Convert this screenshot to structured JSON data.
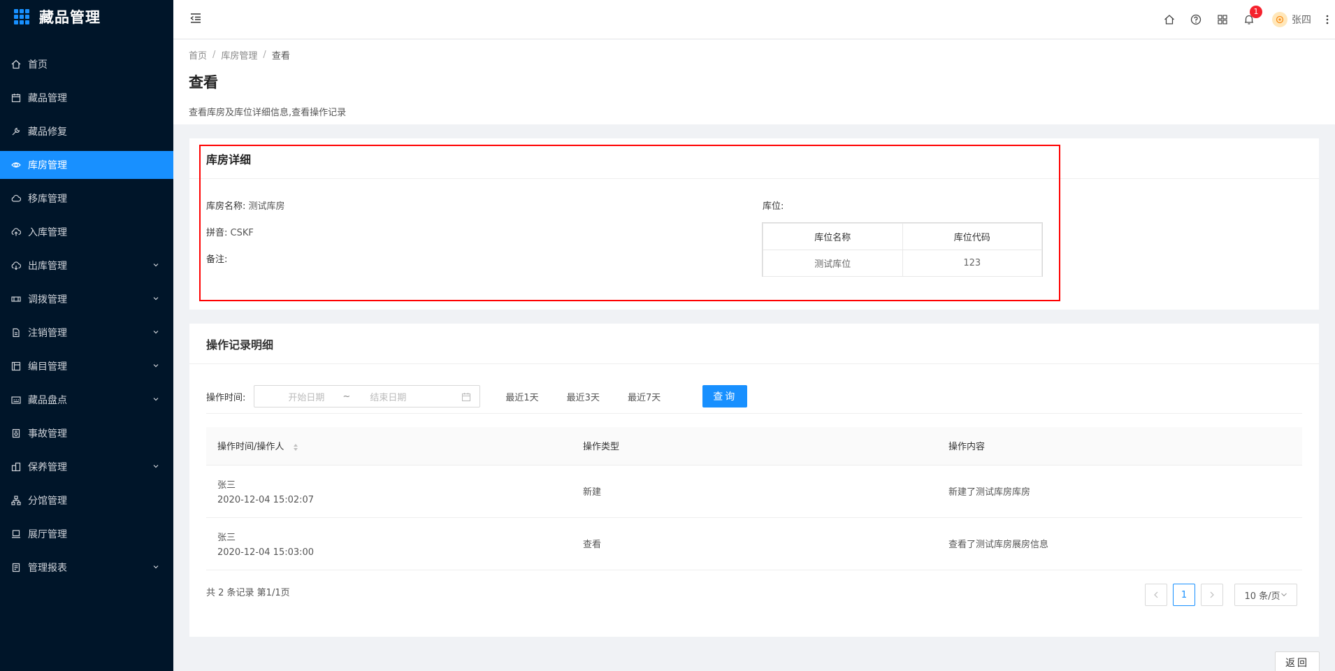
{
  "app": {
    "title": "藏品管理"
  },
  "sidebar": {
    "items": [
      {
        "label": "首页",
        "icon": "home-icon",
        "active": false,
        "has_children": false
      },
      {
        "label": "藏品管理",
        "icon": "calendar-icon",
        "active": false,
        "has_children": false
      },
      {
        "label": "藏品修复",
        "icon": "tool-icon",
        "active": false,
        "has_children": false
      },
      {
        "label": "库房管理",
        "icon": "eye-icon",
        "active": true,
        "has_children": false
      },
      {
        "label": "移库管理",
        "icon": "cloud-icon",
        "active": false,
        "has_children": false
      },
      {
        "label": "入库管理",
        "icon": "cloud-upload-icon",
        "active": false,
        "has_children": false
      },
      {
        "label": "出库管理",
        "icon": "cloud-download-icon",
        "active": false,
        "has_children": true
      },
      {
        "label": "调拨管理",
        "icon": "transfer-icon",
        "active": false,
        "has_children": true
      },
      {
        "label": "注销管理",
        "icon": "file-icon",
        "active": false,
        "has_children": true
      },
      {
        "label": "编目管理",
        "icon": "catalog-icon",
        "active": false,
        "has_children": true
      },
      {
        "label": "藏品盘点",
        "icon": "inventory-icon",
        "active": false,
        "has_children": true
      },
      {
        "label": "事故管理",
        "icon": "report-icon",
        "active": false,
        "has_children": false
      },
      {
        "label": "保养管理",
        "icon": "maintenance-icon",
        "active": false,
        "has_children": true
      },
      {
        "label": "分馆管理",
        "icon": "branch-icon",
        "active": false,
        "has_children": false
      },
      {
        "label": "展厅管理",
        "icon": "laptop-icon",
        "active": false,
        "has_children": false
      },
      {
        "label": "管理报表",
        "icon": "reconciliation-icon",
        "active": false,
        "has_children": true
      }
    ]
  },
  "header": {
    "notification_count": "1",
    "user_name": "张四"
  },
  "breadcrumb": {
    "items": [
      "首页",
      "库房管理",
      "查看"
    ]
  },
  "page": {
    "title": "查看",
    "description": "查看库房及库位详细信息,查看操作记录"
  },
  "warehouse": {
    "section_title": "库房详细",
    "name_label": "库房名称:",
    "name_value": "测试库房",
    "pinyin_label": "拼音:",
    "pinyin_value": "CSKF",
    "remark_label": "备注:",
    "remark_value": "",
    "location_label": "库位:",
    "location_table": {
      "headers": [
        "库位名称",
        "库位代码"
      ],
      "rows": [
        [
          "测试库位",
          "123"
        ]
      ]
    }
  },
  "records": {
    "section_title": "操作记录明细",
    "filter_label": "操作时间:",
    "start_placeholder": "开始日期",
    "range_separator": "~",
    "end_placeholder": "结束日期",
    "quick_ranges": [
      "最近1天",
      "最近3天",
      "最近7天"
    ],
    "query_button": "查询",
    "columns": [
      "操作时间/操作人",
      "操作类型",
      "操作内容"
    ],
    "rows": [
      {
        "operator": "张三",
        "time": "2020-12-04 15:02:07",
        "type": "新建",
        "content": "新建了测试库房库房"
      },
      {
        "operator": "张三",
        "time": "2020-12-04 15:03:00",
        "type": "查看",
        "content": "查看了测试库房展房信息"
      }
    ],
    "total_text": "共 2 条记录 第1/1页",
    "current_page": "1",
    "page_size": "10 条/页"
  },
  "back_button": "返回",
  "colors": {
    "sidebar_bg": "#001529",
    "primary": "#1890ff",
    "highlight_border": "#ff0000",
    "badge": "#f5222d"
  }
}
